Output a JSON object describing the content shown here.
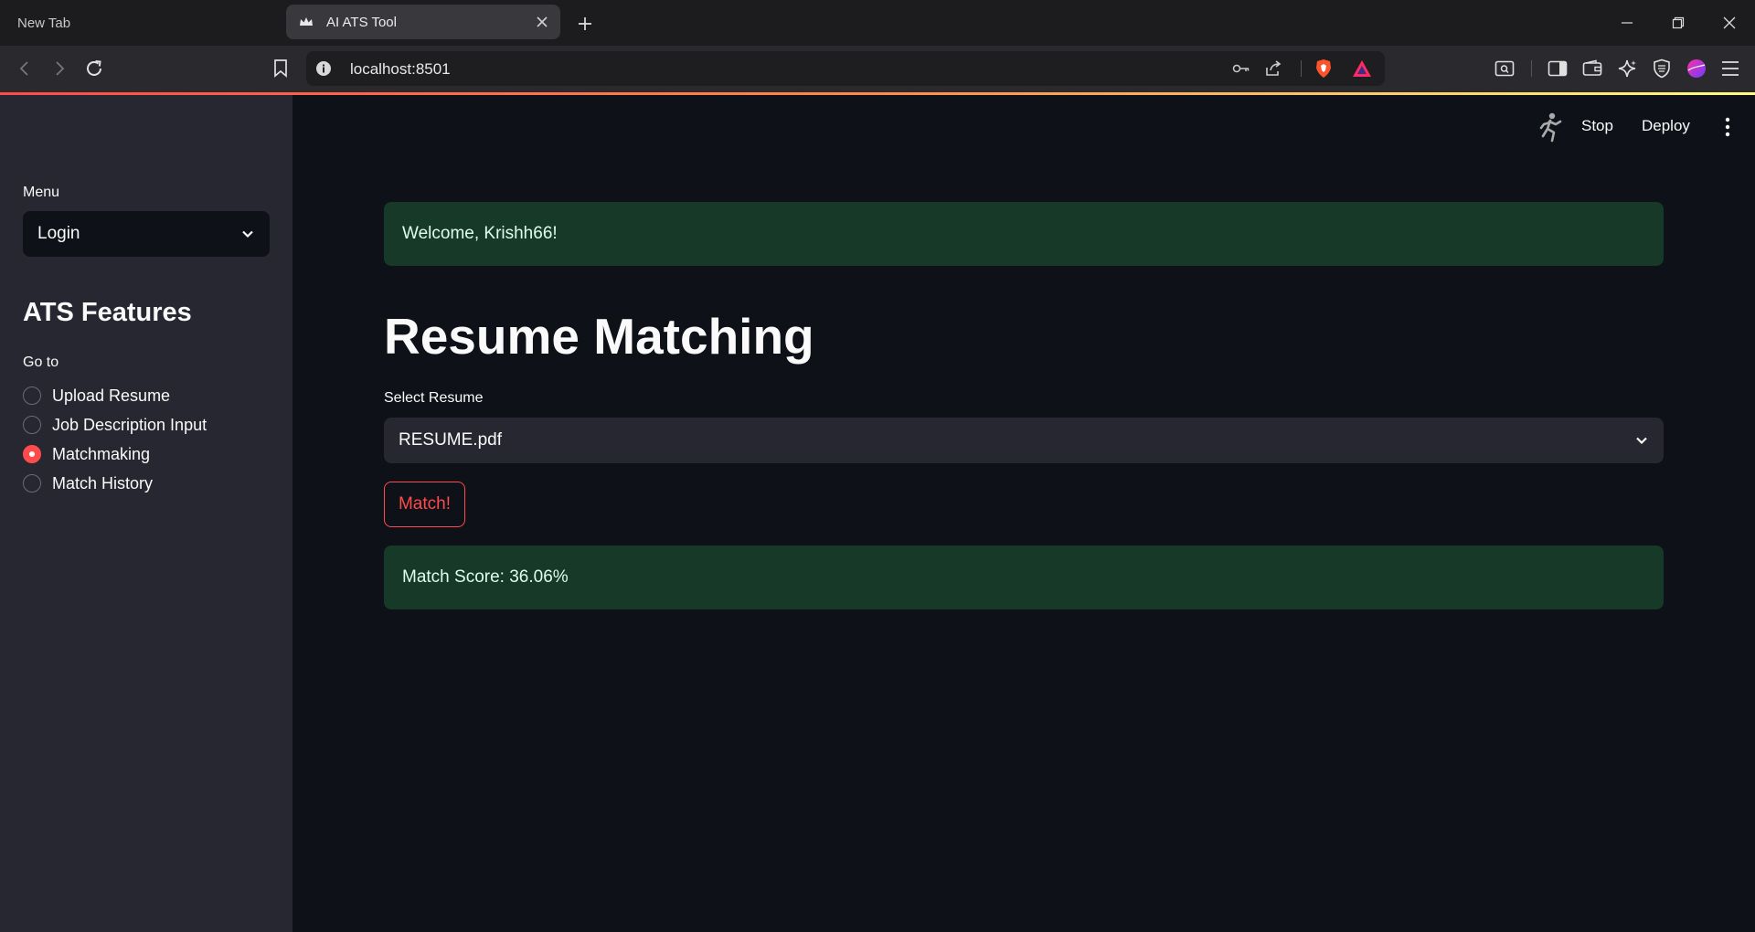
{
  "browser": {
    "tabs": [
      {
        "label": "New Tab",
        "active": false
      },
      {
        "label": "AI ATS Tool",
        "active": true
      }
    ],
    "url": "localhost:8501"
  },
  "sidebar": {
    "menu_label": "Menu",
    "menu_value": "Login",
    "header": "ATS Features",
    "goto_label": "Go to",
    "nav_items": [
      {
        "label": "Upload Resume",
        "selected": false
      },
      {
        "label": "Job Description Input",
        "selected": false
      },
      {
        "label": "Matchmaking",
        "selected": true
      },
      {
        "label": "Match History",
        "selected": false
      }
    ]
  },
  "app_header": {
    "stop_label": "Stop",
    "deploy_label": "Deploy"
  },
  "main": {
    "welcome": "Welcome, Krishh66!",
    "title": "Resume Matching",
    "select_label": "Select Resume",
    "select_value": "RESUME.pdf",
    "match_button": "Match!",
    "result": "Match Score: 36.06%"
  },
  "colors": {
    "accent": "#ff4b4b",
    "success_bg": "#173928",
    "success_text": "#dffde9",
    "sidebar_bg": "#262730",
    "main_bg": "#0e1117"
  }
}
